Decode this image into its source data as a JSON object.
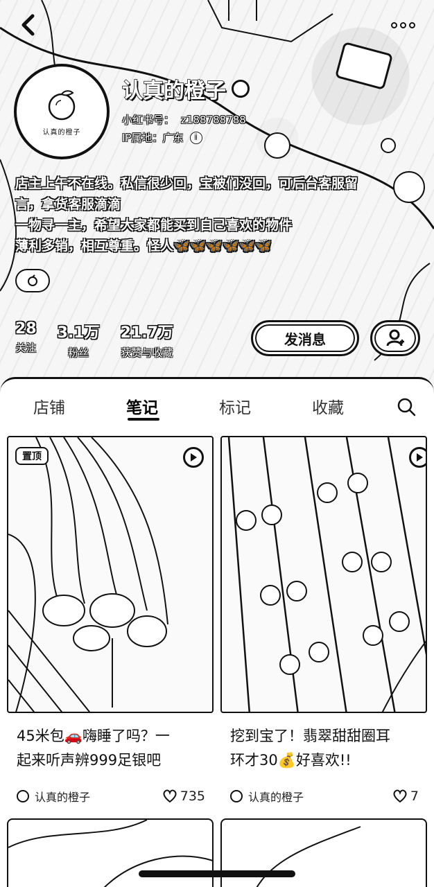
{
  "profile": {
    "name": "认真的橙子",
    "avatar_text": "认真的橙子",
    "id_label": "小红书号：",
    "id_value": "z188788788",
    "ip_label": "IP属地：",
    "ip_value": "广东",
    "bio_lines": [
      "店主上午不在线。私信很少回，宝被们没回，可后台客服留",
      "言，拿货客服滴滴",
      "一物寻一主，希望大家都能买到自己喜欢的物件",
      "薄利多销，相互尊重。怪人🦋🦋🦋🦋🦋🦋"
    ],
    "tag_icon": "orange-icon",
    "stats": [
      {
        "num": "28",
        "label": "关注"
      },
      {
        "num": "3.1万",
        "label": "粉丝"
      },
      {
        "num": "21.7万",
        "label": "获赞与收藏"
      }
    ],
    "message_button": "发消息"
  },
  "tabs": [
    {
      "label": "店铺"
    },
    {
      "label": "笔记"
    },
    {
      "label": "标记"
    },
    {
      "label": "收藏"
    }
  ],
  "active_tab": "笔记",
  "notes": [
    {
      "badge": "置顶",
      "title_line1": "45米包🚗嗨睡了吗？一",
      "title_line2": "起来听声辨999足银吧",
      "author": "认真的橙子",
      "likes": "735"
    },
    {
      "badge": "",
      "title_line1": "挖到宝了！翡翠甜甜圈耳",
      "title_line2": "环才30💰好喜欢!!",
      "author": "认真的橙子",
      "likes": "7"
    }
  ],
  "colors": {
    "ink": "#111111",
    "background": "#ffffff"
  }
}
